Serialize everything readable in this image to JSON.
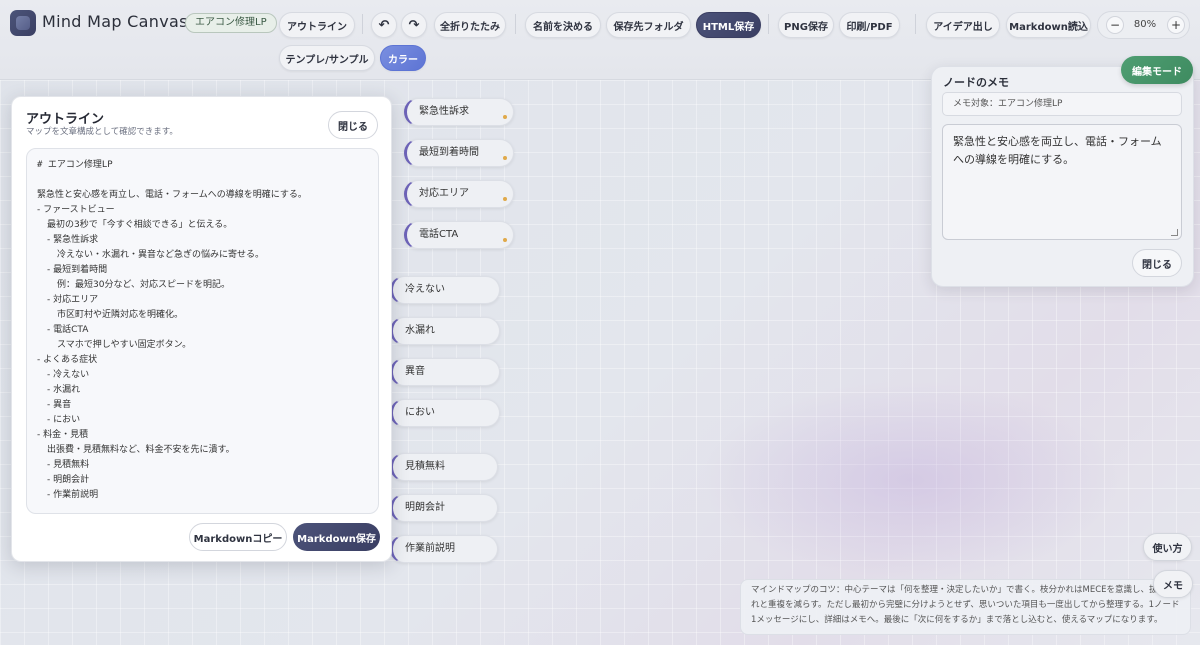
{
  "app": {
    "title": "Mind Map Canvas",
    "project_badge": "エアコン修理LP"
  },
  "toolbar": {
    "outline": "アウトライン",
    "undo": "↶",
    "redo": "↷",
    "collapse_all": "全折りたたみ",
    "name": "名前を決める",
    "save_folder": "保存先フォルダ",
    "html_save": "HTML保存",
    "png_save": "PNG保存",
    "print_pdf": "印刷/PDF",
    "ideas": "アイデア出し",
    "md_import": "Markdown読込",
    "template": "テンプレ/サンプル",
    "color": "カラー",
    "zoom_minus": "−",
    "zoom_level": "80%",
    "zoom_plus": "+"
  },
  "nodes": [
    {
      "label": "緊急性訴求",
      "group": "first_view"
    },
    {
      "label": "最短到着時間",
      "group": "first_view"
    },
    {
      "label": "対応エリア",
      "group": "first_view"
    },
    {
      "label": "電話CTA",
      "group": "first_view"
    },
    {
      "label": "冷えない",
      "group": "symptoms"
    },
    {
      "label": "水漏れ",
      "group": "symptoms"
    },
    {
      "label": "異音",
      "group": "symptoms"
    },
    {
      "label": "におい",
      "group": "symptoms"
    },
    {
      "label": "見積無料",
      "group": "price"
    },
    {
      "label": "明朗会計",
      "group": "price"
    },
    {
      "label": "作業前説明",
      "group": "price"
    }
  ],
  "outline": {
    "title": "アウトライン",
    "subtitle": "マップを文章構成として確認できます。",
    "close": "閉じる",
    "lines": [
      "# エアコン修理LP",
      "",
      "緊急性と安心感を両立し、電話・フォームへの導線を明確にする。",
      "-  ファーストビュー",
      "    最初の3秒で「今すぐ相談できる」と伝える。",
      "    -  緊急性訴求",
      "        冷えない・水漏れ・異音など急ぎの悩みに寄せる。",
      "    -  最短到着時間",
      "        例：最短30分など、対応スピードを明記。",
      "    -  対応エリア",
      "        市区町村や近隣対応を明確化。",
      "    -  電話CTA",
      "        スマホで押しやすい固定ボタン。",
      "-  よくある症状",
      "    -  冷えない",
      "    -  水漏れ",
      "    -  異音",
      "    -  におい",
      "-  料金・見積",
      "    出張費・見積無料など、料金不安を先に潰す。",
      "    -  見積無料",
      "    -  明朗会計",
      "    -  作業前説明"
    ],
    "md_copy": "Markdownコピー",
    "md_save": "Markdown保存"
  },
  "note": {
    "title": "ノードのメモ",
    "edit_mode": "編集モード",
    "target": "メモ対象：エアコン修理LP",
    "text": "緊急性と安心感を両立し、電話・フォームへの導線を明確にする。",
    "close": "閉じる"
  },
  "fab": {
    "help": "使い方",
    "memo": "メモ"
  },
  "tip": "マインドマップのコツ：中心テーマは「何を整理・決定したいか」で書く。枝分かれはMECEを意識し、抜け漏れと重複を減らす。ただし最初から完璧に分けようとせず、思いついた項目も一度出してから整理する。1ノード1メッセージにし、詳細はメモへ。最後に「次に何をするか」まで落とし込むと、使えるマップになります。"
}
